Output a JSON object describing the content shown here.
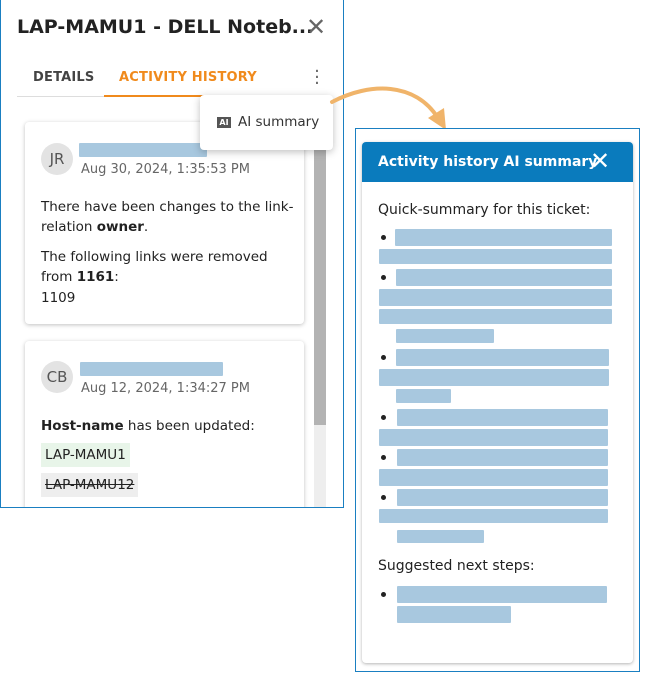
{
  "panel": {
    "title": "LAP-MAMU1 - DELL Noteb...",
    "tabs": [
      {
        "label": "DETAILS"
      },
      {
        "label": "ACTIVITY HISTORY",
        "active": true
      }
    ],
    "accent": "#f08a1c",
    "border": "#1a7fc1"
  },
  "menu": {
    "items": [
      {
        "label": "AI summary",
        "icon": "ai-icon"
      }
    ]
  },
  "activity": [
    {
      "initials": "JR",
      "date": "Aug 30, 2024, 1:35:53 PM",
      "line1": "There have been changes to the link-relation ",
      "line1_bold": "owner",
      "line1_end": ".",
      "line2": "The following links were removed from ",
      "line2_bold": "1161",
      "line2_end": ":",
      "line3": "1109"
    },
    {
      "initials": "CB",
      "date": "Aug 12, 2024, 1:34:27 PM",
      "field": "Host-name",
      "field_rest": " has been updated:",
      "new_value": "LAP-MAMU1",
      "old_value": "LAP-MAMU12"
    }
  ],
  "summary": {
    "title": "Activity history AI summary",
    "header_color": "#0a7bbd",
    "quick_label": "Quick-summary for this ticket:",
    "next_label": "Suggested next steps:"
  }
}
